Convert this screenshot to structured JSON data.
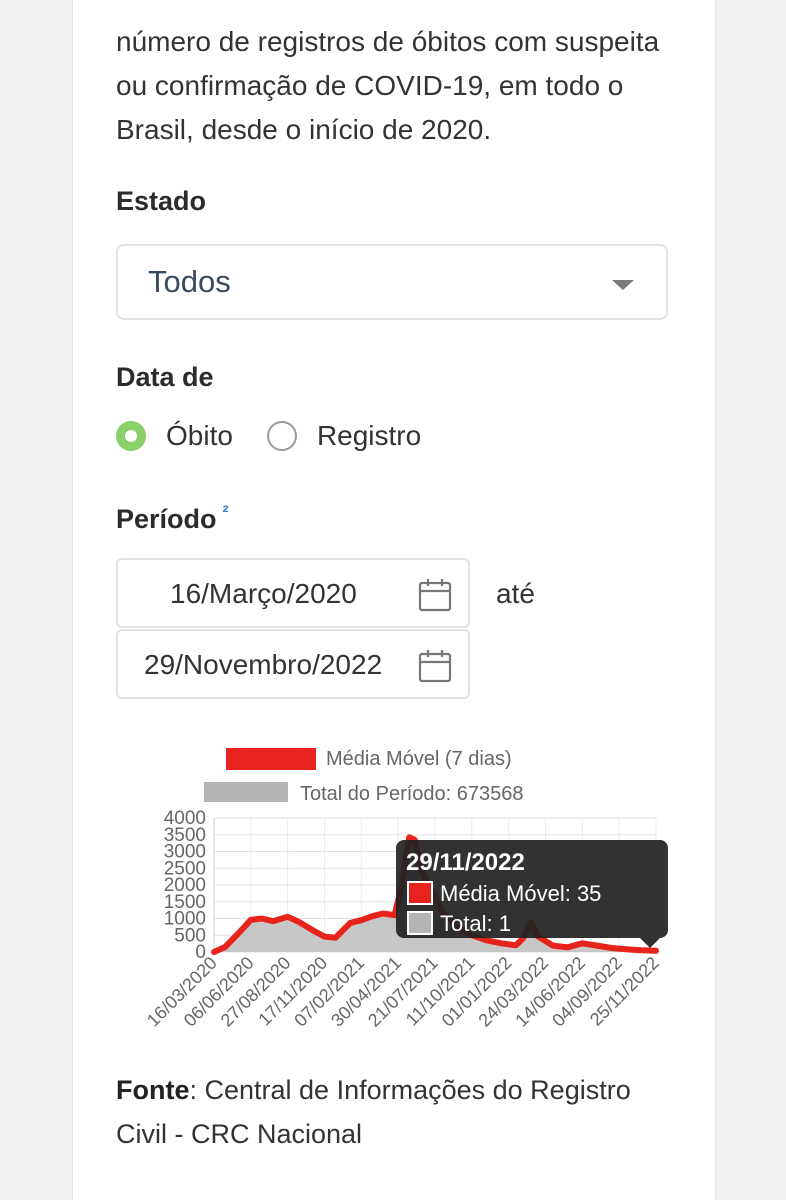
{
  "intro_text": "número de registros de óbitos com suspeita ou confirmação de COVID-19, em todo o Brasil, desde o início de 2020.",
  "estado": {
    "label": "Estado",
    "selected": "Todos"
  },
  "data_de": {
    "label": "Data de",
    "options": [
      {
        "label": "Óbito",
        "checked": true
      },
      {
        "label": "Registro",
        "checked": false
      }
    ]
  },
  "periodo": {
    "label": "Período",
    "footnote": "²",
    "start": "16/Março/2020",
    "end": "29/Novembro/2022",
    "until": "até"
  },
  "colors": {
    "red": "#e8231b",
    "gray": "#b5b5b5",
    "radio_checked": "#8bcf6a",
    "tooltip_bg": "#222222"
  },
  "chart_data": {
    "type": "area",
    "legend": [
      {
        "label": "Média Móvel (7 dias)",
        "color": "#e8231b"
      },
      {
        "label": "Total do Período: 673568",
        "color": "#b5b5b5"
      }
    ],
    "y_ticks": [
      "4000",
      "3500",
      "3000",
      "2500",
      "2000",
      "1500",
      "1000",
      "500",
      "0"
    ],
    "ylim": [
      0,
      4000
    ],
    "x_ticks": [
      "16/03/2020",
      "06/06/2020",
      "27/08/2020",
      "17/11/2020",
      "07/02/2021",
      "30/04/2021",
      "21/07/2021",
      "11/10/2021",
      "01/01/2022",
      "24/03/2022",
      "14/06/2022",
      "04/09/2022",
      "25/11/2022"
    ],
    "series": [
      {
        "name": "Média Móvel (7 dias)",
        "x_index": [
          0,
          0.3,
          0.7,
          1.0,
          1.3,
          1.6,
          2.0,
          2.3,
          2.7,
          3.0,
          3.3,
          3.7,
          4.0,
          4.3,
          4.6,
          4.9,
          5.1,
          5.3,
          5.45,
          5.6,
          5.9,
          6.2,
          6.6,
          7.0,
          7.4,
          7.8,
          8.2,
          8.4,
          8.6,
          8.8,
          9.2,
          9.6,
          10.0,
          10.4,
          10.8,
          11.2,
          11.6,
          12.0
        ],
        "values": [
          0,
          150,
          600,
          960,
          1000,
          920,
          1050,
          900,
          640,
          460,
          430,
          870,
          950,
          1070,
          1150,
          1100,
          2000,
          3420,
          3350,
          2500,
          1850,
          1200,
          750,
          500,
          350,
          260,
          200,
          420,
          880,
          460,
          190,
          140,
          260,
          190,
          120,
          80,
          50,
          35
        ]
      },
      {
        "name": "Total",
        "values_same_as": "Média Móvel (7 dias)"
      }
    ],
    "tooltip": {
      "title": "29/11/2022",
      "rows": [
        {
          "label": "Média Móvel: 35",
          "color": "#e8231b"
        },
        {
          "label": "Total: 1",
          "color": "#b5b5b5"
        }
      ]
    }
  },
  "source": {
    "label": "Fonte",
    "text": ": Central de Informações do Registro Civil - CRC Nacional"
  }
}
